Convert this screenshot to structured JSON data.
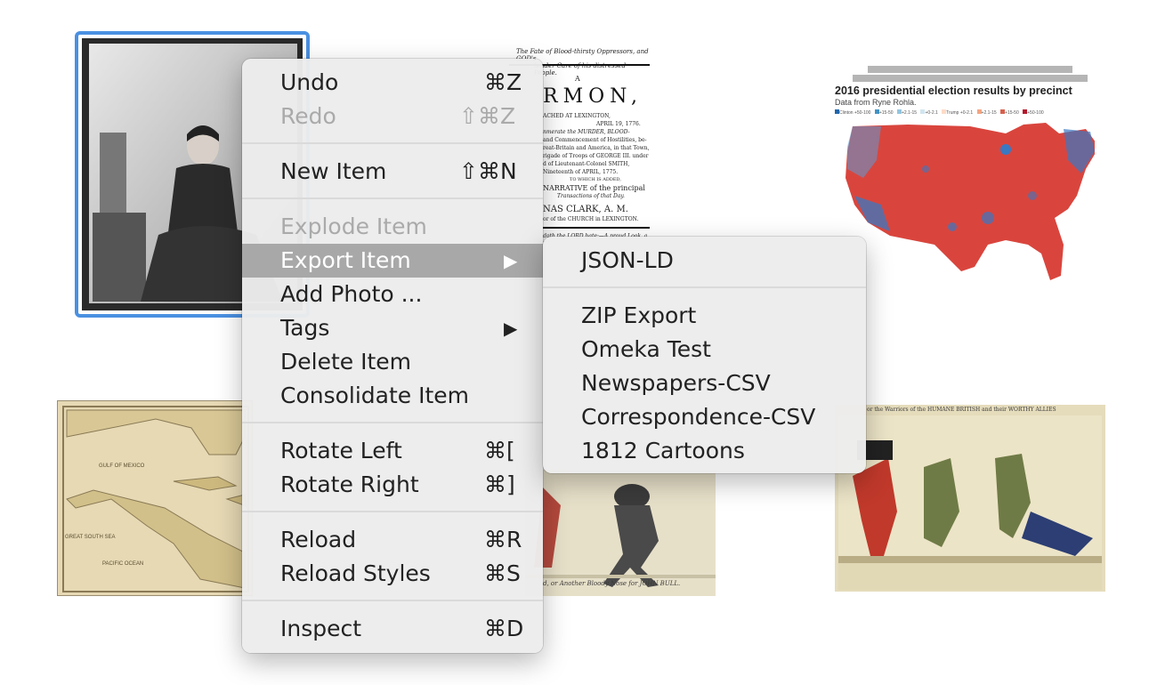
{
  "background_items": {
    "sermon_lines": [
      "The Fate of Blood-thirsty Oppressors, and GOD's",
      "tender Care of his distressed People.",
      "A",
      "RMON,",
      "ACHED AT LEXINGTON,",
      "APRIL 19, 1776.",
      "nmerate the MURDER, BLOOD-",
      "and Commencement of Hostilities, be-",
      "reat-Britain and America, in that Town,",
      "rigade of Troops of GEORGE III. under",
      "d of Lieutenant-Colonel SMITH,",
      "Nineteenth of APRIL, 1775.",
      "TO WHICH IS ADDED,",
      "NARRATIVE of the principal",
      "Transactions of that Day.",
      "NAS CLARK, A. M.",
      "or of the CHURCH in LEXINGTON.",
      "doth the LORD hate:—A proud Look, a lying"
    ],
    "election_map": {
      "title": "2016 presidential election results by precinct",
      "subtitle": "Data from Ryne Rohla.",
      "legend": [
        "Clinton +50-100",
        "+15-50",
        "+2.1-15",
        "+0-2.1",
        "Trump +0-2.1",
        "+2.1-15",
        "+15-50",
        "+50-100"
      ],
      "legend_colors": [
        "#2166ac",
        "#4393c3",
        "#92c5de",
        "#d1e5f0",
        "#fddbc7",
        "#f4a582",
        "#d6604d",
        "#b2182b"
      ]
    },
    "cartoon_caption": "d, or Another Bloody Nose for JOHN BULL.",
    "cartoon2_caption": "or the Warriors of the HUMANE BRITISH and their WORTHY ALLIES",
    "map_labels": [
      "GULF OF MEXICO",
      "GREAT SOUTH SEA",
      "PACIFIC OCEAN"
    ]
  },
  "context_menu": {
    "items": [
      {
        "label": "Undo",
        "shortcut": "⌘Z",
        "disabled": false
      },
      {
        "label": "Redo",
        "shortcut": "⇧⌘Z",
        "disabled": true
      },
      {
        "label": "New Item",
        "shortcut": "⇧⌘N",
        "disabled": false
      },
      {
        "label": "Explode Item",
        "shortcut": "",
        "disabled": true
      },
      {
        "label": "Export Item",
        "shortcut": "",
        "disabled": false,
        "highlighted": true,
        "submenu": true
      },
      {
        "label": "Add Photo ...",
        "shortcut": "",
        "disabled": false
      },
      {
        "label": "Tags",
        "shortcut": "",
        "disabled": false,
        "submenu": true
      },
      {
        "label": "Delete Item",
        "shortcut": "",
        "disabled": false
      },
      {
        "label": "Consolidate Item",
        "shortcut": "",
        "disabled": false
      },
      {
        "label": "Rotate Left",
        "shortcut": "⌘[",
        "disabled": false
      },
      {
        "label": "Rotate Right",
        "shortcut": "⌘]",
        "disabled": false
      },
      {
        "label": "Reload",
        "shortcut": "⌘R",
        "disabled": false
      },
      {
        "label": "Reload Styles",
        "shortcut": "⌘S",
        "disabled": false
      },
      {
        "label": "Inspect",
        "shortcut": "⌘D",
        "disabled": false
      }
    ],
    "submenu_arrow": "▶"
  },
  "export_submenu": {
    "items": [
      "JSON-LD",
      "ZIP Export",
      "Omeka Test",
      "Newspapers-CSV",
      "Correspondence-CSV",
      "1812 Cartoons"
    ]
  },
  "colors": {
    "selection_border": "#4a90e2",
    "menu_background": "#ececec",
    "menu_highlight": "#a8a8a8"
  }
}
